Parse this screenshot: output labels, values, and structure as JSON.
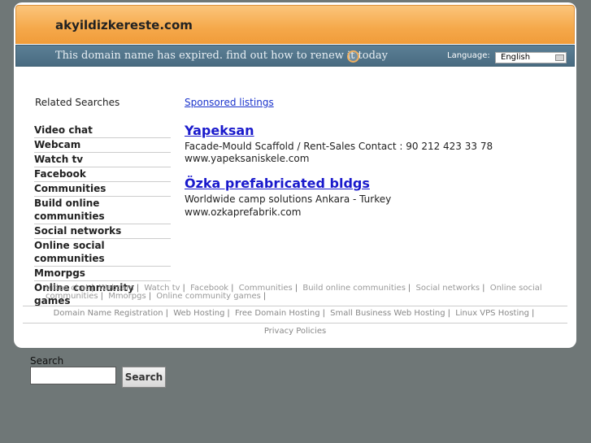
{
  "header": {
    "site_title": "akyildizkereste.com",
    "expired_message": "This domain name has expired. find out how to renew it today",
    "language_label": "Language:",
    "language_selected": "English"
  },
  "related": {
    "heading": "Related Searches",
    "items": [
      "Video chat",
      "Webcam",
      "Watch tv",
      "Facebook",
      "Communities",
      "Build online communities",
      "Social networks",
      "Online social communities",
      "Mmorpgs",
      "Online community games"
    ]
  },
  "sponsored": {
    "label": "Sponsored listings",
    "ads": [
      {
        "title": "Yapeksan",
        "desc": "Facade-Mould Scaffold / Rent-Sales Contact : 90 212 423 33 78",
        "url": "www.yapeksaniskele.com"
      },
      {
        "title": "Özka prefabricated bldgs",
        "desc": "Worldwide camp solutions Ankara - Turkey",
        "url": "www.ozkaprefabrik.com"
      }
    ]
  },
  "footer": {
    "links": [
      "Video chat",
      "Webcam",
      "Watch tv",
      "Facebook",
      "Communities",
      "Build online communities",
      "Social networks",
      "Online social communities",
      "Mmorpgs",
      "Online community games"
    ],
    "links2": [
      "Domain Name Registration",
      "Web Hosting",
      "Free Domain Hosting",
      "Small Business Web Hosting",
      "Linux VPS Hosting"
    ],
    "privacy": "Privacy Policies"
  },
  "search": {
    "label": "Search",
    "button": "Search",
    "value": ""
  }
}
